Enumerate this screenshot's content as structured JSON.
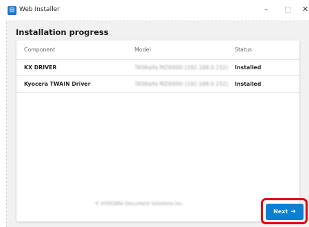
{
  "window": {
    "title": "Web Installer",
    "icon": "web-installer-app-icon",
    "controls": {
      "minimize": "–",
      "maximize": "□",
      "close": "✕"
    }
  },
  "page": {
    "heading": "Installation progress"
  },
  "table": {
    "columns": [
      "Component",
      "Model",
      "Status"
    ],
    "rows": [
      {
        "component": "KX DRIVER",
        "model": "TASKalfa MZ4000i (192.168.0.152)",
        "status": "Installed"
      },
      {
        "component": "Kyocera TWAIN Driver",
        "model": "TASKalfa MZ4000i (192.168.0.152)",
        "status": "Installed"
      }
    ]
  },
  "footer": {
    "text": "© KYOCERA Document Solutions Inc."
  },
  "actions": {
    "next_label": "Next",
    "next_icon": "arrow-right-icon",
    "highlight_color": "#e00000",
    "button_color": "#0a7fd4"
  }
}
